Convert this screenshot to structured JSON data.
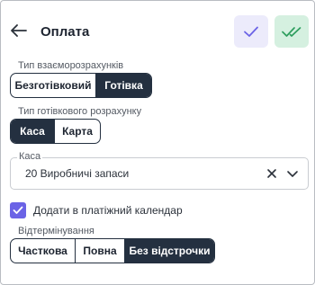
{
  "header": {
    "title": "Оплата",
    "back_icon": "arrow-left-icon",
    "confirm_icon": "check-icon",
    "confirm_all_icon": "double-check-icon"
  },
  "settlement_type": {
    "label": "Тип взаєморозрахунків",
    "options": [
      "Безготівковий",
      "Готівка"
    ],
    "selected": "Готівка"
  },
  "cash_type": {
    "label": "Тип готівкового розрахунку",
    "options": [
      "Каса",
      "Карта"
    ],
    "selected": "Каса"
  },
  "cashbox": {
    "label": "Каса",
    "value": "20 Виробничі запаси",
    "clear_icon": "close-icon",
    "dropdown_icon": "chevron-down-icon"
  },
  "payment_calendar": {
    "label": "Додати в платіжний календар",
    "checked": true
  },
  "deferral": {
    "label": "Відтермінування",
    "options": [
      "Часткова",
      "Повна",
      "Без відстрочки"
    ],
    "selected": "Без відстрочки"
  },
  "colors": {
    "accent": "#6b63e6",
    "segment_active": "#243040",
    "confirm_bg": "#ecebfb",
    "confirm_all_bg": "#d5f0e0",
    "confirm_all_icon": "#2e9e5e"
  }
}
